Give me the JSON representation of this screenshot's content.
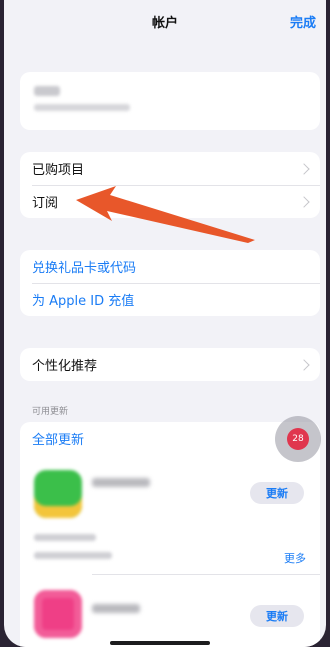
{
  "header": {
    "title": "帐户",
    "done_label": "完成"
  },
  "purchases_section": {
    "items": [
      {
        "label": "已购项目"
      },
      {
        "label": "订阅"
      }
    ]
  },
  "redeem_section": {
    "items": [
      {
        "label": "兑换礼品卡或代码"
      },
      {
        "label": "为 Apple ID 充值"
      }
    ]
  },
  "personalization": {
    "label": "个性化推荐"
  },
  "updates": {
    "section_header": "可用更新",
    "update_all_label": "全部更新",
    "apps": [
      {
        "update_label": "更新",
        "icon_color": "#3bbf4a",
        "icon_accent": "#f3c53a"
      },
      {
        "update_label": "更新",
        "icon_color": "#ef3f86",
        "icon_accent": "#f7a3c6"
      }
    ],
    "more_label": "更多"
  },
  "floating_badge": {
    "count": "28"
  },
  "annotation": {
    "arrow_color": "#e8572a"
  }
}
